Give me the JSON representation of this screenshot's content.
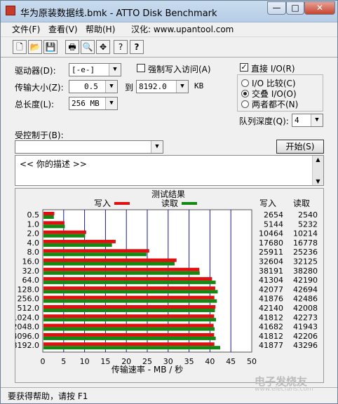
{
  "window": {
    "title": "华为原装数据线.bmk - ATTO Disk Benchmark",
    "min_label": "—",
    "max_label": "□",
    "close_label": "✕"
  },
  "menu": [
    "文件(F)",
    "查看(V)",
    "帮助(H)",
    "汉化: www.upantool.com"
  ],
  "toolbar": [
    {
      "icon": "new-document-icon",
      "glyph": "🗋"
    },
    {
      "icon": "open-folder-icon",
      "glyph": "📂"
    },
    {
      "icon": "save-icon",
      "glyph": "💾"
    },
    {
      "icon": "print-icon",
      "glyph": "🖶"
    },
    {
      "icon": "print-preview-icon",
      "glyph": "🔍"
    },
    {
      "icon": "move-icon",
      "glyph": "✥"
    },
    {
      "icon": "help-icon",
      "glyph": "?"
    },
    {
      "icon": "context-help-icon",
      "glyph": "?"
    }
  ],
  "settings": {
    "drive_label": "驱动器(D):",
    "drive_value": "[-e-]",
    "transfer_label": "传输大小(Z):",
    "transfer_from": "0.5",
    "to_label": "到",
    "transfer_to": "8192.0",
    "transfer_unit": "KB",
    "total_label": "总长度(L):",
    "total_value": "256 MB",
    "force_write_label": "强制写入访问(A)",
    "force_write_checked": false,
    "direct_io_label": "直接 I/O(R)",
    "direct_io_checked": true,
    "io_compare_label": "I/O 比较(C)",
    "overlapped_io_label": "交叠 I/O(O)",
    "neither_label": "两者都不(N)",
    "selected_io_mode": "overlapped",
    "queue_depth_label": "队列深度(Q):",
    "queue_depth_value": "4",
    "controlled_by_label": "受控制于(B):",
    "controlled_by_value": "",
    "start_button_label": "开始(S)",
    "description_text": "<<  你的描述    >>"
  },
  "results": {
    "header": "测试结果",
    "write_col_label": "写入",
    "read_col_label": "读取",
    "legend_write_label": "写入",
    "legend_read_label": "读取",
    "colors": {
      "write": "#e01010",
      "read": "#128a12"
    }
  },
  "chart_data": {
    "type": "bar",
    "orientation": "horizontal",
    "xlabel": "传输速率 - MB / 秒",
    "xlim": [
      0,
      50
    ],
    "xticks": [
      0,
      5,
      10,
      15,
      20,
      25,
      30,
      35,
      40,
      45,
      50
    ],
    "categories": [
      "0.5",
      "1.0",
      "2.0",
      "4.0",
      "8.0",
      "16.0",
      "32.0",
      "64.0",
      "128.0",
      "256.0",
      "512.0",
      "1024.0",
      "2048.0",
      "4096.0",
      "8192.0"
    ],
    "series": [
      {
        "name": "写入",
        "values_kb": [
          2654,
          5144,
          10464,
          17680,
          25911,
          32604,
          38191,
          41304,
          42077,
          41876,
          42140,
          41812,
          41682,
          41812,
          41877
        ]
      },
      {
        "name": "读取",
        "values_kb": [
          2540,
          5232,
          10214,
          16778,
          25236,
          32125,
          38280,
          42190,
          42694,
          42486,
          42008,
          42273,
          41943,
          42206,
          43296
        ]
      }
    ]
  },
  "status": {
    "text": "要获得帮助，请按 F1"
  },
  "watermark": {
    "text": "电子发烧友",
    "url": "www.elecfans.com"
  }
}
